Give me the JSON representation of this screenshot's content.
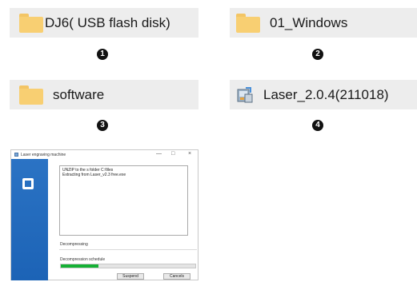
{
  "items": [
    {
      "label": "DJ6( USB flash disk)",
      "badge": "1",
      "icon": "folder-icon"
    },
    {
      "label": "01_Windows",
      "badge": "2",
      "icon": "folder-icon"
    },
    {
      "label": "software",
      "badge": "3",
      "icon": "folder-icon"
    },
    {
      "label": "Laser_2.0.4(211018)",
      "badge": "4",
      "icon": "installer-icon"
    }
  ],
  "installer": {
    "title": "Laser engraving machine",
    "controls": {
      "minimize": "—",
      "maximize": "□",
      "close": "×"
    },
    "log_lines": [
      "UNZIP to the s folder C:\\files",
      "Extracting from Laser_v2.3 free.exe"
    ],
    "status": "Decompressing",
    "schedule_label": "Decompression schedule",
    "progress_percent": 28,
    "suspend_label": "Suspend",
    "cancel_label": "Cancels"
  },
  "colors": {
    "folder": "#f8cf72",
    "bar": "#ededed",
    "accent_blue": "#2b73c4",
    "progress": "#14b034"
  }
}
